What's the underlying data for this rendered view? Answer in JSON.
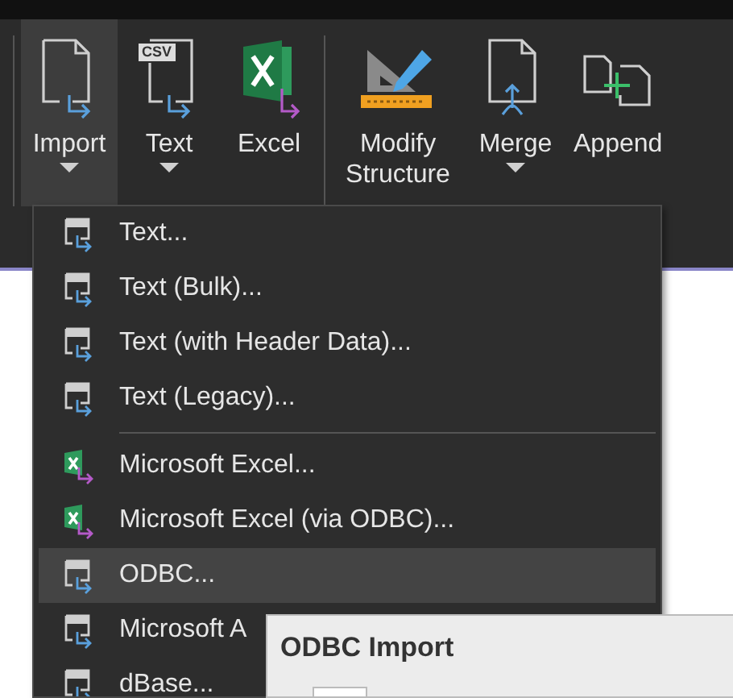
{
  "ribbon": {
    "groups": [
      {
        "buttons": [
          {
            "label": "Import",
            "kind": "document",
            "dropdown": true,
            "selected": true
          },
          {
            "label": "Text",
            "kind": "csv",
            "badge": "CSV",
            "dropdown": true,
            "selected": false
          },
          {
            "label": "Excel",
            "kind": "excel",
            "dropdown": false,
            "selected": false
          }
        ]
      },
      {
        "buttons": [
          {
            "label": "Modify Structure",
            "kind": "ruler",
            "dropdown": false,
            "selected": false
          },
          {
            "label": "Merge",
            "kind": "merge",
            "dropdown": true,
            "selected": false
          },
          {
            "label": "Append",
            "kind": "append",
            "dropdown": false,
            "selected": false
          }
        ]
      }
    ]
  },
  "menu": {
    "sections": [
      [
        {
          "label": "Text...",
          "kind": "text",
          "selected": false
        },
        {
          "label": "Text (Bulk)...",
          "kind": "text",
          "selected": false
        },
        {
          "label": "Text (with Header Data)...",
          "kind": "text",
          "selected": false
        },
        {
          "label": "Text (Legacy)...",
          "kind": "text",
          "selected": false
        }
      ],
      [
        {
          "label": "Microsoft Excel...",
          "kind": "excel",
          "selected": false
        },
        {
          "label": "Microsoft Excel (via ODBC)...",
          "kind": "excel",
          "selected": false
        },
        {
          "label": "ODBC...",
          "kind": "text",
          "selected": true
        },
        {
          "label": "Microsoft A",
          "kind": "text",
          "selected": false
        },
        {
          "label": "dBase...",
          "kind": "text",
          "selected": false
        }
      ]
    ]
  },
  "dialog": {
    "title": "ODBC Import"
  }
}
